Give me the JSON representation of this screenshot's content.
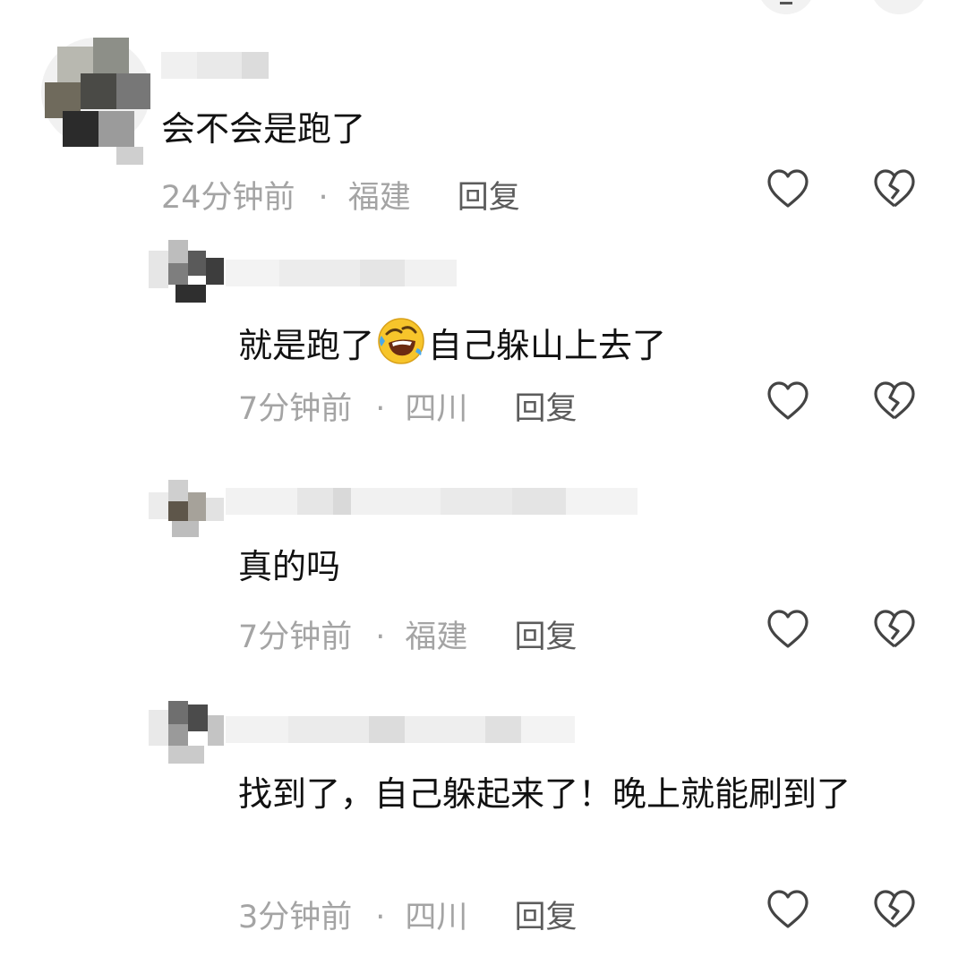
{
  "icons": {
    "like": "heart-outline-icon",
    "dislike": "broken-heart-icon",
    "emoji": "rolling-on-floor-laughing-emoji"
  },
  "colors": {
    "text": "#111111",
    "meta": "#a4a4a4",
    "reply": "#5c5c5c",
    "icon_stroke": "#444444"
  },
  "comments": [
    {
      "text": "会不会是跑了",
      "time": "24分钟前",
      "separator": "·",
      "location": "福建",
      "reply": "回复"
    },
    {
      "text_before": "就是跑了",
      "text_after": "自己躲山上去了",
      "time": "7分钟前",
      "separator": "·",
      "location": "四川",
      "reply": "回复"
    },
    {
      "text": "真的吗",
      "time": "7分钟前",
      "separator": "·",
      "location": "福建",
      "reply": "回复"
    },
    {
      "text": "找到了，自己躲起来了！晚上就能刷到了",
      "time": "3分钟前",
      "separator": "·",
      "location": "四川",
      "reply": "回复"
    }
  ]
}
